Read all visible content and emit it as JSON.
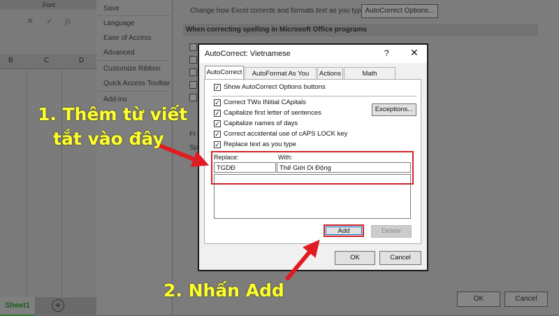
{
  "excel": {
    "ribbon_group": "Font",
    "formula_icons": [
      "✕",
      "✓",
      "fx"
    ],
    "columns": [
      "B",
      "C",
      "D"
    ],
    "sheet_tab": "Sheet1",
    "add_sheet": "+"
  },
  "options": {
    "nav": [
      "Save",
      "Language",
      "Ease of Access",
      "Advanced",
      "Customize Ribbon",
      "Quick Access Toolbar",
      "Add-ins"
    ],
    "autocorrect_text": "Change how Excel corrects and formats text as you type:",
    "autocorrect_button": "AutoCorrect Options...",
    "section_heading": "When correcting spelling in Microsoft Office programs",
    "ok": "OK",
    "cancel": "Cancel",
    "partial_labels": [
      "Fr",
      "Sp"
    ]
  },
  "autocorrect": {
    "title": "AutoCorrect: Vietnamese",
    "help": "?",
    "close": "✕",
    "tabs": [
      "AutoCorrect",
      "AutoFormat As You Type",
      "Actions",
      "Math AutoCorrect"
    ],
    "show_options": "Show AutoCorrect Options buttons",
    "checks": [
      "Correct TWo INitial CApitals",
      "Capitalize first letter of sentences",
      "Capitalize names of days",
      "Correct accidental use of cAPS LOCK key",
      "Replace text as you type"
    ],
    "exceptions": "Exceptions...",
    "replace_label": "Replace:",
    "with_label": "With:",
    "replace_value": "TGDĐ",
    "with_value": "Thế Giới Di Động",
    "add": "Add",
    "delete": "Delete",
    "ok": "OK",
    "cancel": "Cancel"
  },
  "annotations": {
    "step1_line1": "1. Thêm từ viết",
    "step1_line2": "tắt vào đây",
    "step2": "2. Nhấn Add"
  },
  "colors": {
    "annotation": "#ffff2e",
    "highlight": "#d1232a",
    "overlay": "#7b7b7b"
  }
}
